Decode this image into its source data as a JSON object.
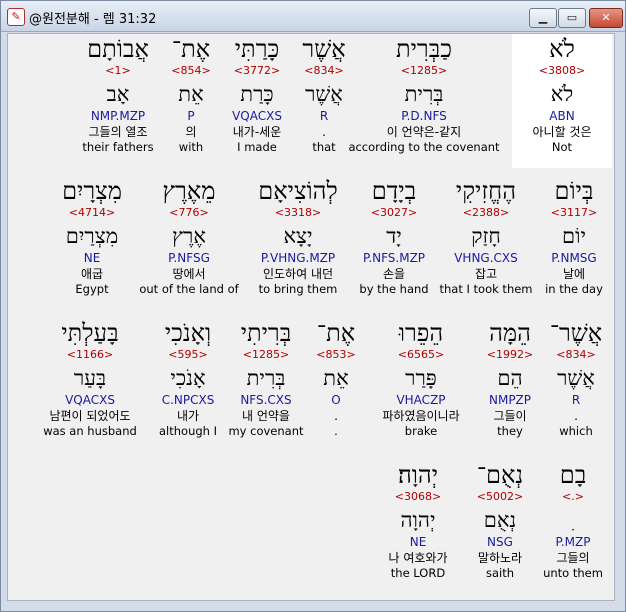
{
  "window": {
    "app_icon": "✎",
    "title": "@원전분해 - 렘 31:32",
    "minimize": "▁",
    "maximize": "▭",
    "close": "✕"
  },
  "rows": [
    [
      {
        "heb": "לֹא",
        "strong": "<3808>",
        "lex": "לֹא",
        "morph": "ABN",
        "kor": "아니할 것은",
        "eng": "Not"
      },
      {
        "heb": "כַבְּרִית",
        "strong": "<1285>",
        "lex": "בְּרִית",
        "morph": "P.D.NFS",
        "kor": "이 언약은-같지",
        "eng": "according to the covenant"
      },
      {
        "heb": "אֲשֶׁר",
        "strong": "<834>",
        "lex": "אֲשֶׁר",
        "morph": "R",
        "kor": ".",
        "eng": "that"
      },
      {
        "heb": "כָּרַתִּי",
        "strong": "<3772>",
        "lex": "כָּרַת",
        "morph": "VQACXS",
        "kor": "내가-세운",
        "eng": "I made"
      },
      {
        "heb": "אֶת־",
        "strong": "<854>",
        "lex": "אֵת",
        "morph": "P",
        "kor": "의",
        "eng": "with"
      },
      {
        "heb": "אֲבוֹתָם",
        "strong": "<1>",
        "lex": "אָב",
        "morph": "NMP.MZP",
        "kor": "그들의 열조",
        "eng": "their fathers"
      }
    ],
    [
      {
        "heb": "בְּיוֹם",
        "strong": "<3117>",
        "lex": "יוֹם",
        "morph": "P.NMSG",
        "kor": "날에",
        "eng": "in the day"
      },
      {
        "heb": "הֶחֱזִיקִי",
        "strong": "<2388>",
        "lex": "חָזַק",
        "morph": "VHNG.CXS",
        "kor": "잡고",
        "eng": "that I took them"
      },
      {
        "heb": "בְיָדָם",
        "strong": "<3027>",
        "lex": "יָד",
        "morph": "P.NFS.MZP",
        "kor": "손을",
        "eng": "by the hand"
      },
      {
        "heb": "לְהוֹצִיאָם",
        "strong": "<3318>",
        "lex": "יָצָא",
        "morph": "P.VHNG.MZP",
        "kor": "인도하여 내던",
        "eng": "to bring them"
      },
      {
        "heb": "מֵאֶרֶץ",
        "strong": "<776>",
        "lex": "אֶרֶץ",
        "morph": "P.NFSG",
        "kor": "땅에서",
        "eng": "out of the land of"
      },
      {
        "heb": "מִצְרָיִם",
        "strong": "<4714>",
        "lex": "מִצְרַיִם",
        "morph": "NE",
        "kor": "애굽",
        "eng": "Egypt"
      }
    ],
    [
      {
        "heb": "אֲשֶׁר־",
        "strong": "<834>",
        "lex": "אֲשֶׁר",
        "morph": "R",
        "kor": ".",
        "eng": "which"
      },
      {
        "heb": "הֵמָּה",
        "strong": "<1992>",
        "lex": "הֵם",
        "morph": "NMPZP",
        "kor": "그들이",
        "eng": "they"
      },
      {
        "heb": "הֵפֵרוּ",
        "strong": "<6565>",
        "lex": "פָּרַר",
        "morph": "VHACZP",
        "kor": "파하였음이니라",
        "eng": "brake"
      },
      {
        "heb": "אֶת־",
        "strong": "<853>",
        "lex": "אֵת",
        "morph": "O",
        "kor": ".",
        "eng": "."
      },
      {
        "heb": "בְּרִיתִי",
        "strong": "<1285>",
        "lex": "בְּרִית",
        "morph": "NFS.CXS",
        "kor": "내 언약을",
        "eng": "my covenant"
      },
      {
        "heb": "וְאָנֹכִי",
        "strong": "<595>",
        "lex": "אָנֹכִי",
        "morph": "C.NPCXS",
        "kor": "내가",
        "eng": "although I"
      },
      {
        "heb": "בָּעַלְתִּי",
        "strong": "<1166>",
        "lex": "בָּעַר",
        "morph": "VQACXS",
        "kor": "남편이 되었어도",
        "eng": "was an husband"
      }
    ],
    [
      {
        "heb": "בָם",
        "strong": "<.>",
        "lex": "ִ",
        "morph": "P.MZP",
        "kor": "그들의",
        "eng": "unto them"
      },
      {
        "heb": "נְאֻם־",
        "strong": "<5002>",
        "lex": "נְאֻם",
        "morph": "NSG",
        "kor": "말하노라",
        "eng": "saith"
      },
      {
        "heb": "יְהוָה׃",
        "strong": "<3068>",
        "lex": "יְהוָה",
        "morph": "NE",
        "kor": "나 여호와가",
        "eng": "the LORD"
      }
    ]
  ]
}
